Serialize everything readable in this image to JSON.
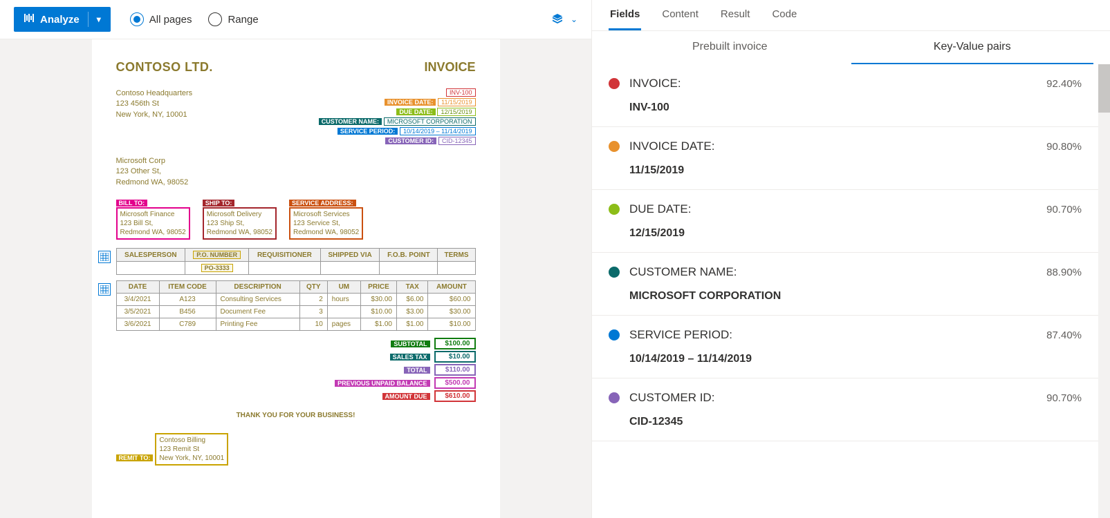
{
  "toolbar": {
    "analyze_label": "Analyze",
    "all_pages_label": "All pages",
    "range_label": "Range"
  },
  "document": {
    "company": "CONTOSO LTD.",
    "title": "INVOICE",
    "hq_address": {
      "line1": "Contoso Headquarters",
      "line2": "123 456th St",
      "line3": "New York, NY, 10001"
    },
    "customer_address": {
      "line1": "Microsoft Corp",
      "line2": "123 Other St,",
      "line3": "Redmond WA, 98052"
    },
    "tags": {
      "invoice_label": "INVOICE:",
      "invoice_value": "INV-100",
      "invoice_date_label": "INVOICE DATE:",
      "invoice_date_value": "11/15/2019",
      "due_date_label": "DUE DATE:",
      "due_date_value": "12/15/2019",
      "customer_name_label": "CUSTOMER NAME:",
      "customer_name_value": "MICROSOFT CORPORATION",
      "service_period_label": "SERVICE PERIOD:",
      "service_period_value": "10/14/2019 – 11/14/2019",
      "customer_id_label": "CUSTOMER ID:",
      "customer_id_value": "CID-12345"
    },
    "cards": {
      "bill_to_label": "BILL TO:",
      "bill_to": {
        "line1": "Microsoft Finance",
        "line2": "123 Bill St,",
        "line3": "Redmond WA, 98052"
      },
      "ship_to_label": "SHIP TO:",
      "ship_to": {
        "line1": "Microsoft Delivery",
        "line2": "123 Ship St,",
        "line3": "Redmond WA, 98052"
      },
      "service_addr_label": "SERVICE ADDRESS:",
      "service_addr": {
        "line1": "Microsoft Services",
        "line2": "123 Service St,",
        "line3": "Redmond WA, 98052"
      }
    },
    "meta_table": {
      "headers": {
        "salesperson": "SALESPERSON",
        "po_number": "P.O. NUMBER",
        "requisitioner": "REQUISITIONER",
        "shipped_via": "SHIPPED VIA",
        "fob_point": "F.O.B. POINT",
        "terms": "TERMS"
      },
      "po_value": "PO-3333"
    },
    "line_table": {
      "headers": {
        "date": "DATE",
        "item_code": "ITEM CODE",
        "description": "DESCRIPTION",
        "qty": "QTY",
        "um": "UM",
        "price": "PRICE",
        "tax": "TAX",
        "amount": "AMOUNT"
      },
      "rows": [
        {
          "date": "3/4/2021",
          "item_code": "A123",
          "description": "Consulting Services",
          "qty": "2",
          "um": "hours",
          "price": "$30.00",
          "tax": "$6.00",
          "amount": "$60.00"
        },
        {
          "date": "3/5/2021",
          "item_code": "B456",
          "description": "Document Fee",
          "qty": "3",
          "um": "",
          "price": "$10.00",
          "tax": "$3.00",
          "amount": "$30.00"
        },
        {
          "date": "3/6/2021",
          "item_code": "C789",
          "description": "Printing Fee",
          "qty": "10",
          "um": "pages",
          "price": "$1.00",
          "tax": "$1.00",
          "amount": "$10.00"
        }
      ]
    },
    "summary": {
      "subtotal_label": "SUBTOTAL",
      "subtotal": "$100.00",
      "sales_tax_label": "SALES TAX",
      "sales_tax": "$10.00",
      "total_label": "TOTAL",
      "total": "$110.00",
      "prev_label": "PREVIOUS UNPAID BALANCE",
      "prev": "$500.00",
      "amount_due_label": "AMOUNT DUE",
      "amount_due": "$610.00"
    },
    "thanks": "THANK YOU FOR YOUR BUSINESS!",
    "remit_label": "REMIT TO:",
    "remit": {
      "line1": "Contoso Billing",
      "line2": "123 Remit St",
      "line3": "New York, NY, 10001"
    }
  },
  "colors": {
    "invoice": "#d13438",
    "invoice_date": "#e8912d",
    "due_date": "#8cbd18",
    "customer_name": "#0b6a6a",
    "service_period": "#0078d4",
    "customer_id": "#8764b8",
    "bill_to": "#e3008c",
    "ship_to": "#a4262c",
    "service_addr": "#ca5010",
    "subtotal": "#107c10",
    "sales_tax": "#0b6a6a",
    "total": "#8764b8",
    "prev": "#c239b3",
    "amount_due": "#d13438",
    "remit": "#c9a300",
    "po": "#c9a300"
  },
  "tabs": {
    "fields": "Fields",
    "content": "Content",
    "result": "Result",
    "code": "Code"
  },
  "subtabs": {
    "prebuilt": "Prebuilt invoice",
    "kvp": "Key-Value pairs"
  },
  "fields": [
    {
      "name": "INVOICE:",
      "value": "INV-100",
      "confidence": "92.40%",
      "color": "#d13438"
    },
    {
      "name": "INVOICE DATE:",
      "value": "11/15/2019",
      "confidence": "90.80%",
      "color": "#e8912d"
    },
    {
      "name": "DUE DATE:",
      "value": "12/15/2019",
      "confidence": "90.70%",
      "color": "#8cbd18"
    },
    {
      "name": "CUSTOMER NAME:",
      "value": "MICROSOFT CORPORATION",
      "confidence": "88.90%",
      "color": "#0b6a6a"
    },
    {
      "name": "SERVICE PERIOD:",
      "value": "10/14/2019 – 11/14/2019",
      "confidence": "87.40%",
      "color": "#0078d4"
    },
    {
      "name": "CUSTOMER ID:",
      "value": "CID-12345",
      "confidence": "90.70%",
      "color": "#8764b8"
    }
  ]
}
